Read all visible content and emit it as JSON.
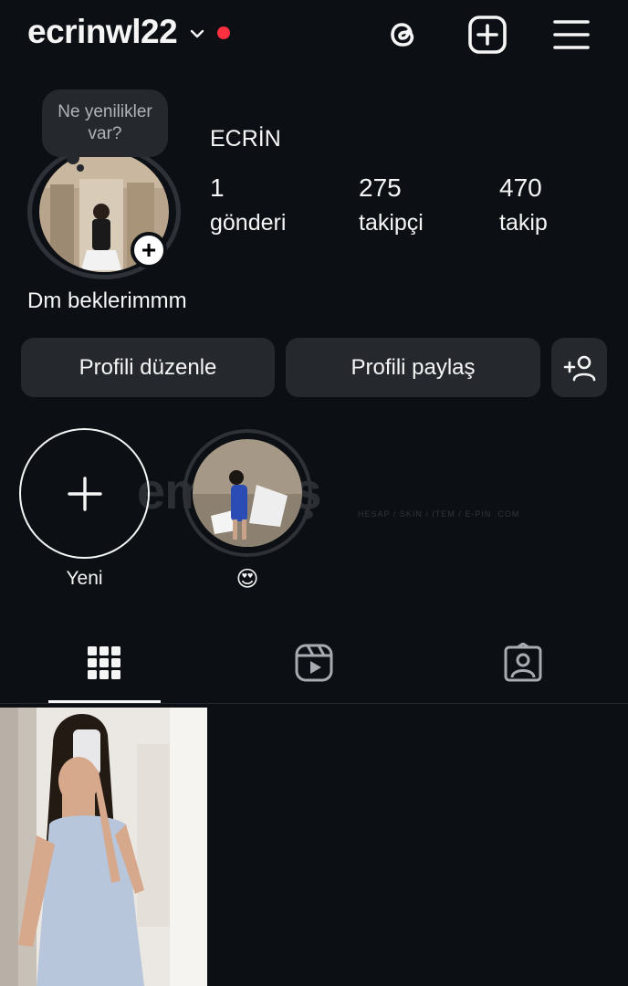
{
  "header": {
    "username": "ecrinwl22",
    "icons": [
      "chevron-down-icon",
      "threads-icon",
      "new-post-icon",
      "menu-icon"
    ],
    "live_dot_color": "#ff3040"
  },
  "profile": {
    "note": "Ne yenilikler var?",
    "display_name": "ECRİN",
    "stats": {
      "posts": {
        "value": "1",
        "label": "gönderi"
      },
      "followers": {
        "value": "275",
        "label": "takipçi"
      },
      "following": {
        "value": "470",
        "label": "takip"
      }
    },
    "bio": "Dm beklerimmm"
  },
  "buttons": {
    "edit_profile": "Profili düzenle",
    "share_profile": "Profili paylaş"
  },
  "highlights": [
    {
      "label": "Yeni"
    },
    {
      "label": "😍"
    }
  ],
  "watermark": {
    "text": "emsatış",
    "sub": "HESAP / SKIN / ITEM / E-PIN .COM"
  },
  "tabs": [
    "grid-icon",
    "reels-icon",
    "tagged-icon"
  ],
  "colors": {
    "background": "#0c1014",
    "button": "#25292e",
    "text": "#f5f5f5"
  }
}
